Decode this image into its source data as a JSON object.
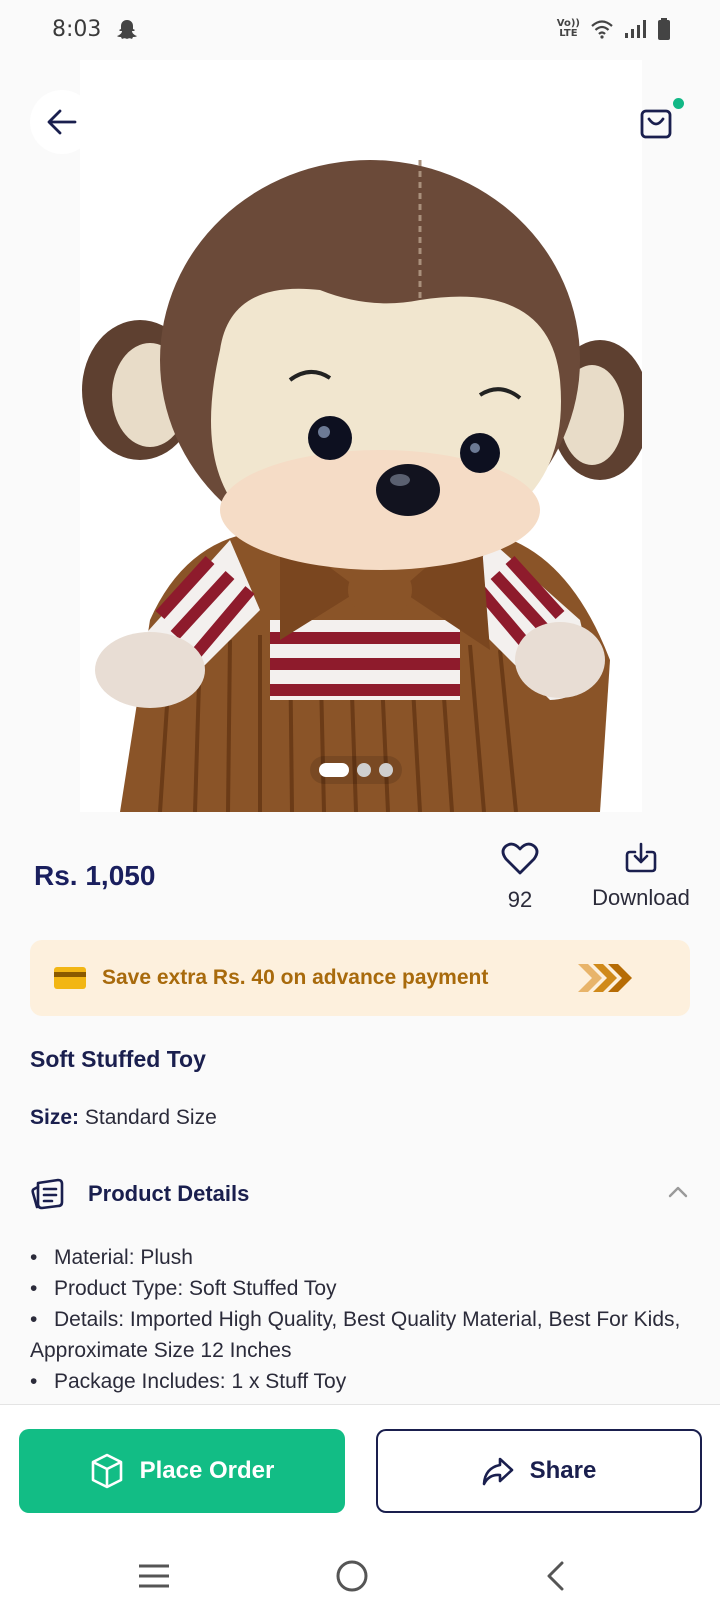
{
  "status_bar": {
    "time": "8:03",
    "volte_top": "Vo))",
    "volte_bottom": "LTE"
  },
  "product": {
    "price": "Rs. 1,050",
    "wishlist_count": "92",
    "download_label": "Download",
    "title": "Soft Stuffed Toy",
    "size_label": "Size:",
    "size_value": "Standard Size",
    "image_count": 3,
    "image_active_index": 0
  },
  "offer": {
    "text": "Save extra Rs. 40 on advance payment"
  },
  "details": {
    "heading": "Product Details",
    "items": [
      "Material: Plush",
      "Product Type: Soft Stuffed Toy",
      "Details: Imported High Quality, Best Quality Material, Best For Kids, Approximate Size 12 Inches",
      "Package Includes: 1 x Stuff Toy"
    ]
  },
  "actions": {
    "place_order": "Place Order",
    "share": "Share"
  },
  "colors": {
    "accent_green": "#12bd85",
    "navy": "#1a1f4e",
    "offer_bg": "#fdf0dd",
    "offer_text": "#a86a0c"
  }
}
